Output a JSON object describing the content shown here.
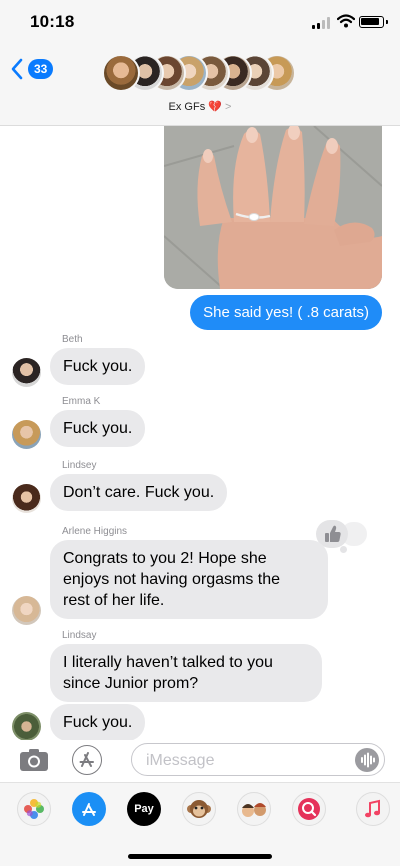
{
  "status_bar": {
    "time": "10:18"
  },
  "header": {
    "back_count": "33",
    "group_name": "Ex GFs",
    "heart": "💔",
    "chevron": ">"
  },
  "thread": {
    "sent_message": "She said yes! ( .8 carats)",
    "messages": [
      {
        "sender": "Beth",
        "text": "Fuck you."
      },
      {
        "sender": "Emma K",
        "text": "Fuck you."
      },
      {
        "sender": "Lindsey",
        "text": "Don’t care. Fuck you."
      },
      {
        "sender": "Arlene  Higgins",
        "text_lines": [
          "Congrats to you 2! Hope she",
          "enjoys not having orgasms the",
          "rest of her life."
        ]
      },
      {
        "sender": "Lindsay",
        "text_lines": [
          "I literally haven’t talked to you",
          "since Junior prom?"
        ]
      },
      {
        "sender": "",
        "text": "Fuck you."
      }
    ],
    "tapback_icon": "thumbs-up-icon"
  },
  "compose": {
    "placeholder": "iMessage"
  },
  "app_strip": {
    "apple_pay_label": "Pay"
  },
  "colors": {
    "accent": "#0a7bfe",
    "sent_bubble": "#1f8cf8",
    "received_bubble": "#e9e9eb",
    "bar_background": "#f6f6f6"
  }
}
